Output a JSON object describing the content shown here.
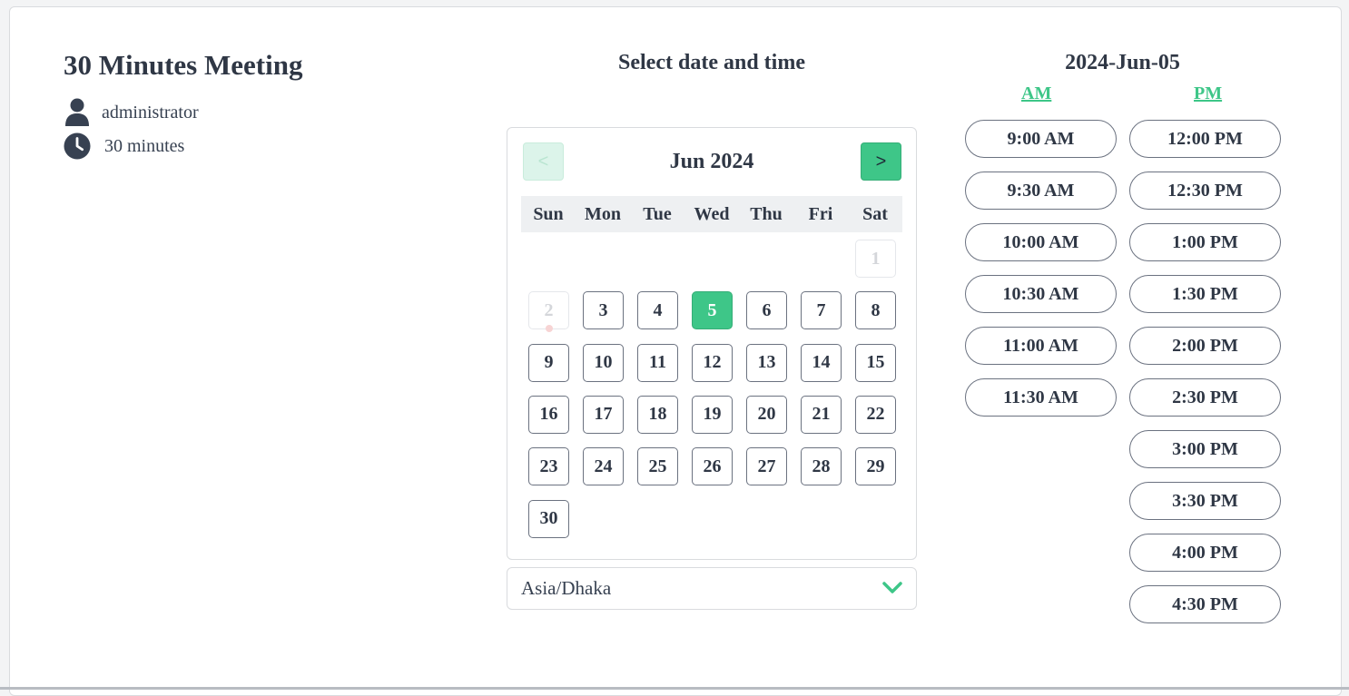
{
  "meeting": {
    "title": "30 Minutes Meeting",
    "host": "administrator",
    "duration": "30 minutes"
  },
  "selector": {
    "title": "Select date and time",
    "prev_label": "<",
    "next_label": ">",
    "month_label": "Jun 2024",
    "weekdays": [
      "Sun",
      "Mon",
      "Tue",
      "Wed",
      "Thu",
      "Fri",
      "Sat"
    ],
    "days": [
      "1",
      "2",
      "3",
      "4",
      "5",
      "6",
      "7",
      "8",
      "9",
      "10",
      "11",
      "12",
      "13",
      "14",
      "15",
      "16",
      "17",
      "18",
      "19",
      "20",
      "21",
      "22",
      "23",
      "24",
      "25",
      "26",
      "27",
      "28",
      "29",
      "30"
    ],
    "selected_day": "5",
    "disabled_days": [
      "1",
      "2"
    ]
  },
  "timezone": {
    "value": "Asia/Dhaka"
  },
  "times": {
    "date_title": "2024-Jun-05",
    "am_label": "AM",
    "pm_label": "PM",
    "am_slots": [
      "9:00 AM",
      "9:30 AM",
      "10:00 AM",
      "10:30 AM",
      "11:00 AM",
      "11:30 AM"
    ],
    "pm_slots": [
      "12:00 PM",
      "12:30 PM",
      "1:00 PM",
      "1:30 PM",
      "2:00 PM",
      "2:30 PM",
      "3:00 PM",
      "3:30 PM",
      "4:00 PM",
      "4:30 PM"
    ]
  },
  "colors": {
    "accent": "#3ec688",
    "text": "#2f3745"
  }
}
